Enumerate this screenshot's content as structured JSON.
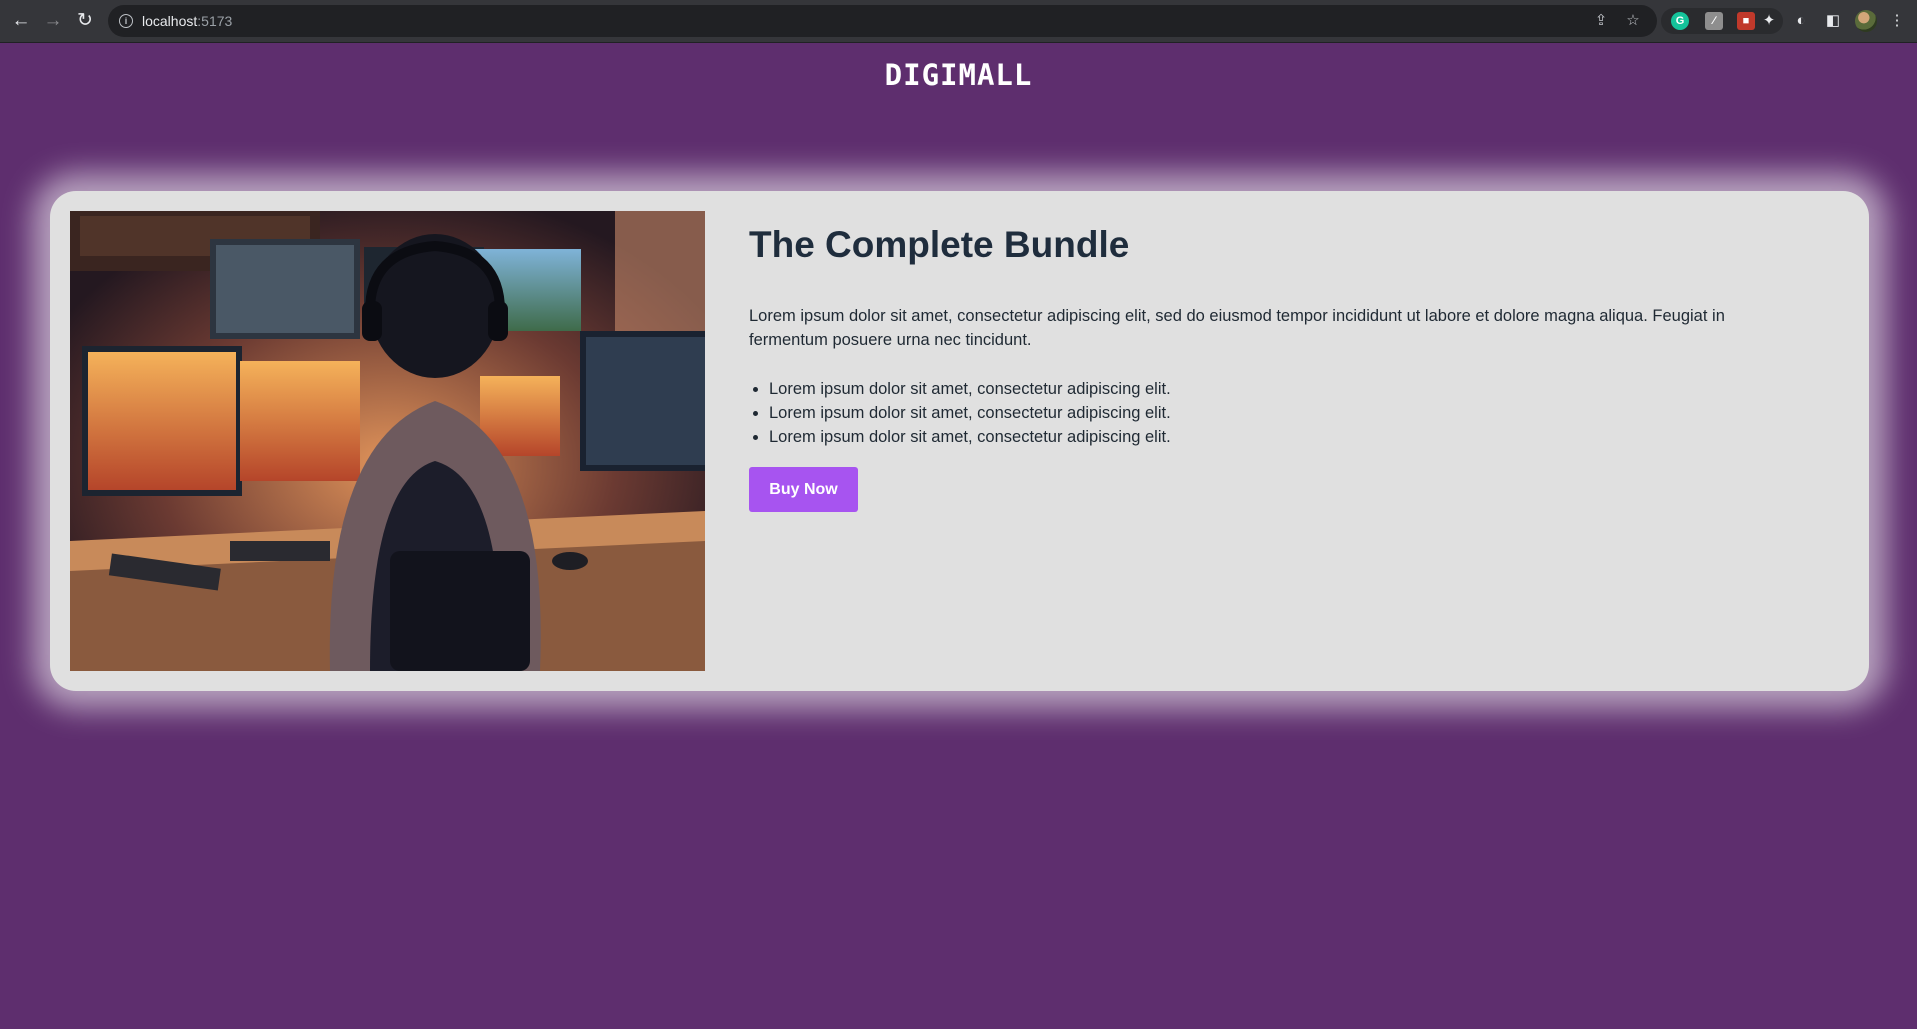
{
  "browser": {
    "url_host": "localhost",
    "url_port": ":5173"
  },
  "site": {
    "title": "DIGIMALL"
  },
  "product": {
    "title": "The Complete Bundle",
    "description": "Lorem ipsum dolor sit amet, consectetur adipiscing elit, sed do eiusmod tempor incididunt ut labore et dolore magna aliqua. Feugiat in fermentum posuere urna nec tincidunt.",
    "features": [
      "Lorem ipsum dolor sit amet, consectetur adipiscing elit.",
      "Lorem ipsum dolor sit amet, consectetur adipiscing elit.",
      "Lorem ipsum dolor sit amet, consectetur adipiscing elit."
    ],
    "buy_label": "Buy Now"
  },
  "colors": {
    "page_background": "#5e2e6e",
    "card_background": "#e0e0e0",
    "accent": "#a754f0",
    "heading": "#1f2d3d"
  }
}
